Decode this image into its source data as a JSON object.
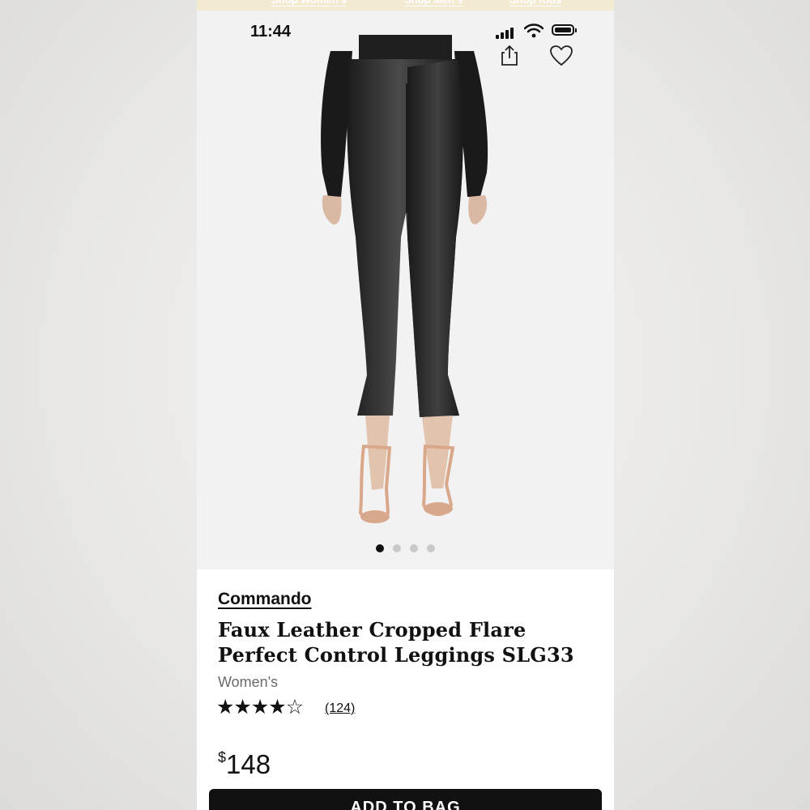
{
  "top_nav": {
    "links": [
      "Shop Women's",
      "Shop Men's",
      "Shop Kids"
    ]
  },
  "status_bar": {
    "time": "11:44"
  },
  "product": {
    "brand": "Commando",
    "title_line1": "Faux Leather Cropped Flare",
    "title_line2": "Perfect Control Leggings SLG33",
    "gender": "Women's",
    "rating": 4,
    "rating_max": 5,
    "review_count": "(124)",
    "price_currency": "$",
    "price_amount": "148",
    "add_to_bag": "ADD TO BAG"
  },
  "carousel": {
    "total": 4,
    "active": 1
  },
  "icons": {
    "share": "share-icon",
    "wishlist": "heart-icon",
    "signal": "cellular-signal-icon",
    "wifi": "wifi-icon",
    "battery": "battery-icon"
  },
  "colors": {
    "text": "#111111",
    "muted": "#6b6b6b",
    "photo_bg": "#f2f2f2",
    "button_bg": "#111111",
    "banner": "#f3ead2"
  }
}
